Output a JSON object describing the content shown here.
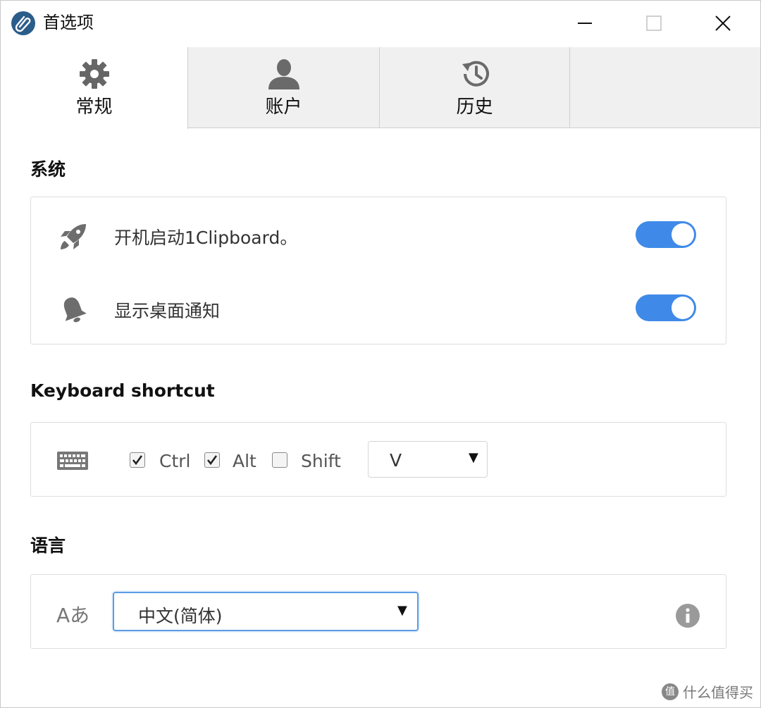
{
  "window": {
    "title": "首选项",
    "app_icon": "paperclip-icon"
  },
  "tabs": [
    {
      "label": "常规",
      "icon": "gear-icon",
      "active": true
    },
    {
      "label": "账户",
      "icon": "user-icon",
      "active": false
    },
    {
      "label": "历史",
      "icon": "history-icon",
      "active": false
    }
  ],
  "system": {
    "title": "系统",
    "rows": [
      {
        "label": "开机启动1Clipboard。",
        "icon": "rocket-icon",
        "enabled": true
      },
      {
        "label": "显示桌面通知",
        "icon": "bell-icon",
        "enabled": true
      }
    ]
  },
  "shortcut": {
    "title": "Keyboard shortcut",
    "icon": "keyboard-icon",
    "modifiers": [
      {
        "label": "Ctrl",
        "checked": true
      },
      {
        "label": "Alt",
        "checked": true
      },
      {
        "label": "Shift",
        "checked": false
      }
    ],
    "key": "V"
  },
  "language": {
    "title": "语言",
    "icon": "language-icon",
    "icon_text": "Aあ",
    "selected": "中文(简体)",
    "info_icon": "info-icon"
  },
  "watermark": {
    "badge": "值",
    "text": "什么值得买"
  },
  "colors": {
    "toggle_on": "#3f8ae8",
    "focus_border": "#5b9ce6"
  }
}
